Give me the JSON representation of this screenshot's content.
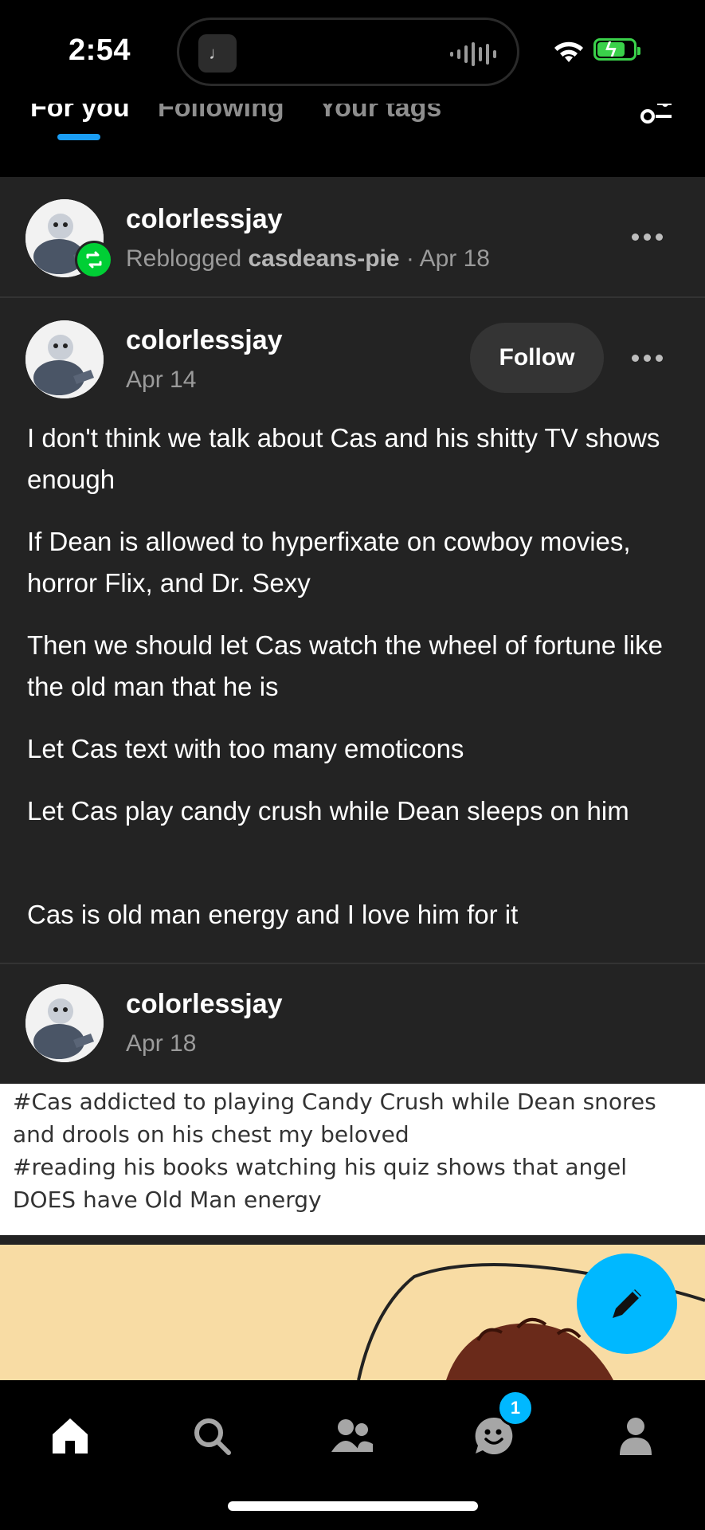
{
  "status": {
    "time": "2:54",
    "island_app_glyph": "♩"
  },
  "tabs": [
    {
      "label": "For you",
      "active": true
    },
    {
      "label": "Following",
      "active": false
    },
    {
      "label": "Your tags",
      "active": false
    }
  ],
  "reblog_header": {
    "username": "colorlessjay",
    "reblogged_prefix": "Reblogged",
    "reblogged_from": "casdeans-pie",
    "date_suffix": "· Apr 18"
  },
  "post": {
    "username": "colorlessjay",
    "date": "Apr 14",
    "follow_label": "Follow",
    "paragraphs": [
      "I don't think we talk about Cas and his shitty TV shows enough",
      "If Dean is allowed to hyperfixate on cowboy movies, horror Flix, and Dr. Sexy",
      "Then we should let Cas watch the wheel of fortune like the old man that he is",
      "Let Cas text with too many emoticons",
      "Let Cas play candy crush while Dean sleeps on him",
      "Cas is old man energy and I love him for it"
    ]
  },
  "reply": {
    "username": "colorlessjay",
    "date": "Apr 18",
    "tag_lines": [
      "#Cas addicted to playing Candy Crush while Dean snores",
      "and drools on his chest my beloved",
      "#reading his books watching his quiz shows that angel",
      "DOES have Old Man energy"
    ]
  },
  "nav": {
    "items": [
      "home-icon",
      "search-icon",
      "community-icon",
      "activity-icon",
      "profile-icon"
    ],
    "activity_badge": "1"
  },
  "colors": {
    "accent": "#00b8ff",
    "reblog": "#00cf35",
    "card": "#232323"
  }
}
